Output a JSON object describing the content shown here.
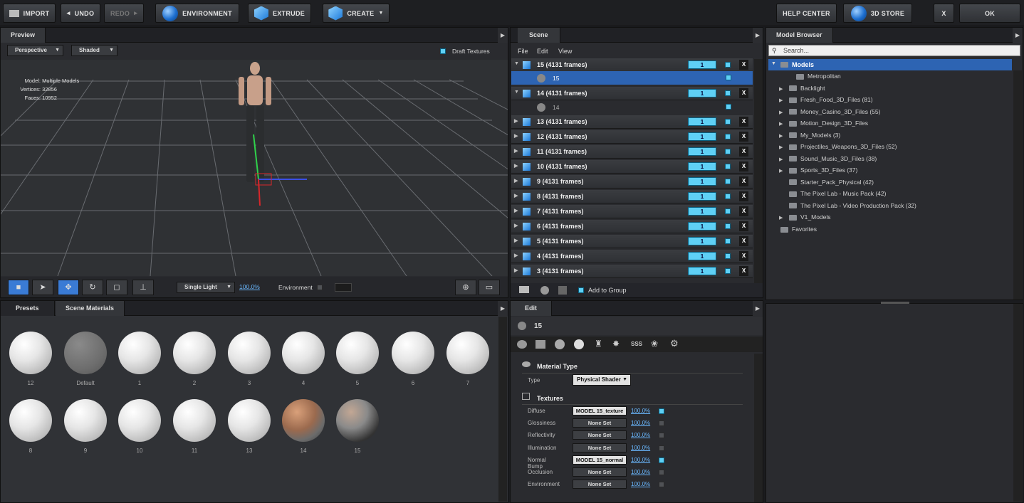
{
  "toolbar": {
    "import": "IMPORT",
    "undo": "UNDO",
    "redo": "REDO",
    "environment": "ENVIRONMENT",
    "extrude": "EXTRUDE",
    "create": "CREATE",
    "help": "HELP CENTER",
    "store": "3D STORE",
    "close": "X",
    "ok": "OK"
  },
  "preview": {
    "tab": "Preview",
    "view": "Perspective",
    "shading": "Shaded",
    "draft": "Draft Textures",
    "model_label": "Model:",
    "model_value": "Multiple Models",
    "vertices_label": "Vertices:",
    "vertices_value": "32856",
    "faces_label": "Faces:",
    "faces_value": "10952",
    "light": "Single Light",
    "light_pct": "100.0%",
    "environment": "Environment"
  },
  "scene": {
    "tab": "Scene",
    "menu": [
      "File",
      "Edit",
      "View"
    ],
    "rows": [
      {
        "label": "15 (4131 frames)",
        "num": "1"
      },
      {
        "label": "14 (4131 frames)",
        "num": "1"
      },
      {
        "label": "13 (4131 frames)",
        "num": "1"
      },
      {
        "label": "12 (4131 frames)",
        "num": "1"
      },
      {
        "label": "11 (4131 frames)",
        "num": "1"
      },
      {
        "label": "10 (4131 frames)",
        "num": "1"
      },
      {
        "label": "9 (4131 frames)",
        "num": "1"
      },
      {
        "label": "8 (4131 frames)",
        "num": "1"
      },
      {
        "label": "7 (4131 frames)",
        "num": "1"
      },
      {
        "label": "6 (4131 frames)",
        "num": "1"
      },
      {
        "label": "5 (4131 frames)",
        "num": "1"
      },
      {
        "label": "4 (4131 frames)",
        "num": "1"
      },
      {
        "label": "3 (4131 frames)",
        "num": "1"
      }
    ],
    "sub15": "15",
    "sub14": "14",
    "add_group": "Add to Group"
  },
  "browser": {
    "tab": "Model Browser",
    "search": "Search...",
    "root": "Models",
    "items": [
      "Metropolitan",
      "Backlight",
      "Fresh_Food_3D_Files (81)",
      "Money_Casino_3D_Files (55)",
      "Motion_Design_3D_Files",
      "My_Models (3)",
      "Projectiles_Weapons_3D_Files (52)",
      "Sound_Music_3D_Files (38)",
      "Sports_3D_Files (37)",
      "Starter_Pack_Physical (42)",
      "The Pixel Lab - Music Pack (42)",
      "The Pixel Lab - Video Production Pack (32)",
      "V1_Models"
    ],
    "favorites": "Favorites"
  },
  "materials": {
    "tab_presets": "Presets",
    "tab_scene": "Scene Materials",
    "labels": [
      "12",
      "Default",
      "1",
      "2",
      "3",
      "4",
      "5",
      "6",
      "7",
      "8",
      "9",
      "10",
      "11",
      "13",
      "14",
      "15"
    ]
  },
  "edit": {
    "tab": "Edit",
    "name": "15",
    "material_type": "Material Type",
    "type_label": "Type",
    "type_value": "Physical Shader",
    "textures": "Textures",
    "rows": [
      {
        "name": "Diffuse",
        "value": "MODEL 15_texture",
        "pct": "100.0%",
        "on": true
      },
      {
        "name": "Glossiness",
        "value": "None Set",
        "pct": "100.0%",
        "on": false
      },
      {
        "name": "Reflectivity",
        "value": "None Set",
        "pct": "100.0%",
        "on": false
      },
      {
        "name": "Illumination",
        "value": "None Set",
        "pct": "100.0%",
        "on": false
      },
      {
        "name": "Normal Bump",
        "value": "MODEL 15_normal",
        "pct": "100.0%",
        "on": true
      },
      {
        "name": "Occlusion",
        "value": "None Set",
        "pct": "100.0%",
        "on": false
      },
      {
        "name": "Environment",
        "value": "None Set",
        "pct": "100.0%",
        "on": false
      }
    ]
  }
}
